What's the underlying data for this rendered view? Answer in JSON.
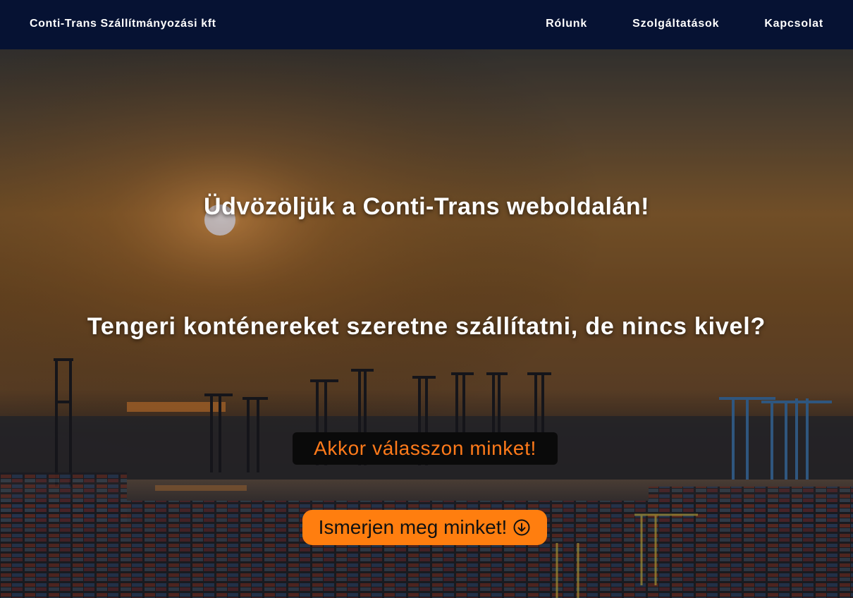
{
  "navbar": {
    "brand": "Conti-Trans Szállítmányozási kft",
    "links": [
      {
        "label": "Rólunk"
      },
      {
        "label": "Szolgáltatások"
      },
      {
        "label": "Kapcsolat"
      }
    ]
  },
  "hero": {
    "welcome": "Üdvözöljük a Conti-Trans weboldalán!",
    "question": "Tengeri konténereket szeretne szállítatni, de nincs kivel?",
    "answer": "Akkor válasszon minket!",
    "button_label": "Ismerjen meg minket!",
    "button_icon": "arrow-down-circle-icon"
  },
  "colors": {
    "navbar": "#061233",
    "accent": "#ff7e0f",
    "answer_text": "#ff7a1a"
  }
}
